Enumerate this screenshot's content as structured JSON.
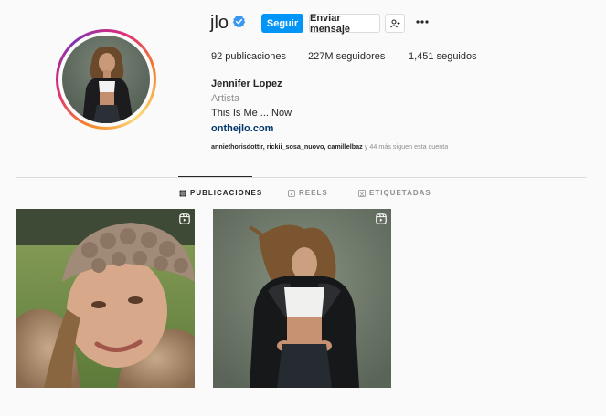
{
  "profile": {
    "username": "jlo",
    "full_name": "Jennifer Lopez",
    "category": "Artista",
    "bio": "This Is Me ... Now",
    "website": "onthejlo.com",
    "followed_by_names": "anniethorisdottir, rickii_sosa_nuovo, camillelbaz",
    "followed_by_suffix": " y 44 más siguen esta cuenta"
  },
  "actions": {
    "follow_label": "Seguir",
    "message_label": "Enviar mensaje"
  },
  "stats": {
    "posts": "92 publicaciones",
    "followers": "227M seguidores",
    "following": "1,451 seguidos"
  },
  "tabs": [
    {
      "label": "PUBLICACIONES",
      "icon": "grid-icon",
      "active": true
    },
    {
      "label": "REELS",
      "icon": "reels-icon",
      "active": false
    },
    {
      "label": "ETIQUETADAS",
      "icon": "tagged-icon",
      "active": false
    }
  ],
  "posts": [
    {
      "type": "reel"
    },
    {
      "type": "reel"
    }
  ],
  "colors": {
    "accent": "#0095f6",
    "link": "#00376b",
    "verified": "#3897f0"
  }
}
